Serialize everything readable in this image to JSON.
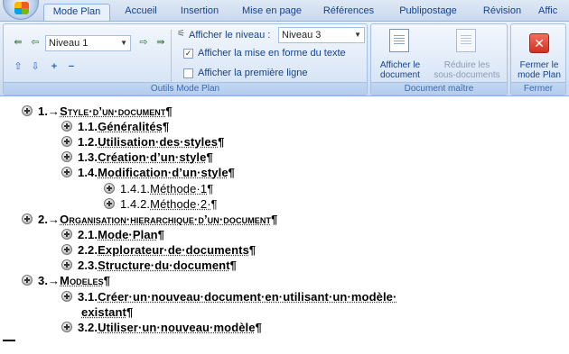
{
  "ribbon": {
    "tabs": [
      {
        "label": "Mode Plan",
        "active": true
      },
      {
        "label": "Accueil"
      },
      {
        "label": "Insertion"
      },
      {
        "label": "Mise en page"
      },
      {
        "label": "Références"
      },
      {
        "label": "Publipostage"
      },
      {
        "label": "Révision"
      },
      {
        "label": "Affic"
      }
    ],
    "outline_tools": {
      "group_label": "Outils Mode Plan",
      "level_combo": "Niveau 1",
      "show_level_label": "Afficher le niveau :",
      "show_level_combo": "Niveau 3",
      "show_formatting_label": "Afficher la mise en forme du texte",
      "show_formatting_checked": true,
      "show_first_line_label": "Afficher la première ligne",
      "show_first_line_checked": false,
      "promote_heading_icon": "double-left-arrow-icon",
      "promote_icon": "left-arrow-icon",
      "demote_icon": "right-arrow-icon",
      "demote_body_icon": "double-right-arrow-icon",
      "move_up_icon": "up-arrow-icon",
      "move_down_icon": "down-arrow-icon",
      "expand_icon": "plus-icon",
      "collapse_icon": "minus-icon"
    },
    "master_document": {
      "group_label": "Document maître",
      "show_document_line1": "Afficher le",
      "show_document_line2": "document",
      "collapse_subdocs_line1": "Réduire les",
      "collapse_subdocs_line2": "sous-documents"
    },
    "close": {
      "group_label": "Fermer",
      "close_line1": "Fermer le",
      "close_line2": "mode Plan"
    }
  },
  "outline": {
    "rows": [
      {
        "num": "1.→",
        "text": "Style·d’un·document",
        "mark": "¶",
        "level": 1
      },
      {
        "num": "1.1.",
        "text": "Généralités",
        "mark": "¶",
        "level": 2
      },
      {
        "num": "1.2.",
        "text": "Utilisation·des·styles",
        "mark": "¶",
        "level": 2
      },
      {
        "num": "1.3.",
        "text": "Création·d’un·style",
        "mark": "¶",
        "level": 2
      },
      {
        "num": "1.4.",
        "text": "Modification·d’un·style",
        "mark": "¶",
        "level": 2
      },
      {
        "num": "1.4.1.",
        "text": "Méthode·1",
        "mark": "¶",
        "level": 3
      },
      {
        "num": "1.4.2.",
        "text": "Méthode·2·",
        "mark": "¶",
        "level": 3
      },
      {
        "num": "2.→",
        "text": "Organisation·hierarchique·d’un·document",
        "mark": "¶",
        "level": 1
      },
      {
        "num": "2.1.",
        "text": "Mode·Plan",
        "mark": "¶",
        "level": 2
      },
      {
        "num": "2.2.",
        "text": "Explorateur·de·documents",
        "mark": "¶",
        "level": 2
      },
      {
        "num": "2.3.",
        "text": "Structure·du·document",
        "mark": "¶",
        "level": 2
      },
      {
        "num": "3.→",
        "text": "Modeles",
        "mark": "¶",
        "level": 1
      },
      {
        "num": "3.1.",
        "text": "Créer·un·nouveau·document·en·utilisant·un·modèle·",
        "mark": "",
        "level": 2
      },
      {
        "num": "",
        "text": "existant",
        "mark": "¶",
        "level": 2
      },
      {
        "num": "3.2.",
        "text": "Utiliser·un·nouveau·modèle",
        "mark": "¶",
        "level": 2
      }
    ]
  }
}
